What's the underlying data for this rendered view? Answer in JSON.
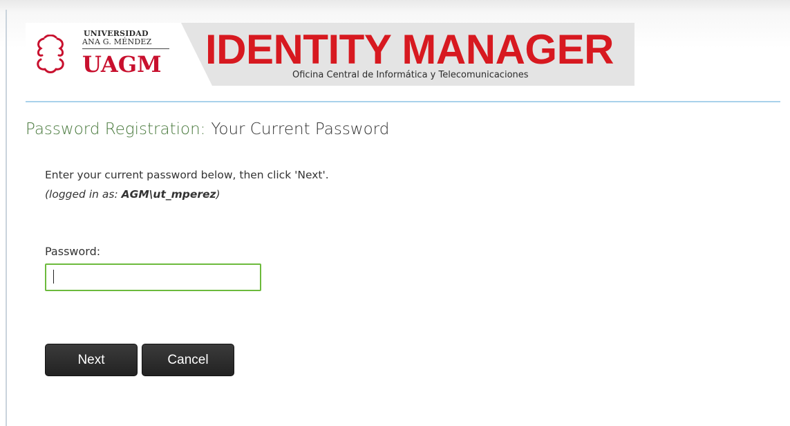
{
  "header": {
    "university_line1": "UNIVERSIDAD",
    "university_line2": "ANA G. MÉNDEZ",
    "university_short": "UAGM",
    "app_title": "IDENTITY MANAGER",
    "app_subtitle": "Oficina Central de Informática y Telecomunicaciones"
  },
  "page": {
    "heading": "Password Registration:",
    "heading_step": "Your Current Password",
    "instructions": "Enter your current password below, then click 'Next'.",
    "logged_in_prefix": "(logged in as: ",
    "logged_in_user": "AGM\\ut_mperez",
    "logged_in_suffix": ")"
  },
  "form": {
    "password_label": "Password:",
    "password_value": ""
  },
  "buttons": {
    "next_label": "Next",
    "cancel_label": "Cancel"
  },
  "colors": {
    "title_red": "#d71920",
    "heading_green": "#4a7a3e",
    "input_focus_border": "#6cba3c",
    "header_rule": "#a8d1ea",
    "button_dark": "#2b2b2b"
  }
}
